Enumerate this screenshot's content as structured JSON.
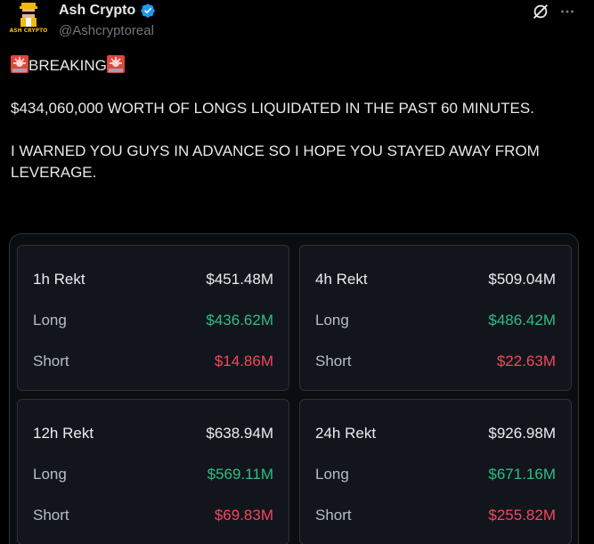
{
  "author": {
    "name": "Ash Crypto",
    "handle": "@Ashcryptoreal",
    "avatar_text": "ASH CRYPTO",
    "verified_icon": "verified-badge-icon"
  },
  "header_icons": [
    "grok-icon",
    "more-icon"
  ],
  "tweet": {
    "headline": "BREAKING",
    "paragraph_1": "$434,060,000 WORTH OF LONGS LIQUIDATED IN THE PAST 60 MINUTES.",
    "paragraph_2": "I WARNED YOU GUYS IN ADVANCE SO I HOPE YOU STAYED AWAY FROM LEVERAGE."
  },
  "colors": {
    "background": "#000000",
    "long": "#2ebd85",
    "short": "#f6465d",
    "verified": "#1d9bf0"
  },
  "rekt_cards": [
    {
      "title": "1h Rekt",
      "total": "$451.48M",
      "long_label": "Long",
      "long": "$436.62M",
      "short_label": "Short",
      "short": "$14.86M"
    },
    {
      "title": "4h Rekt",
      "total": "$509.04M",
      "long_label": "Long",
      "long": "$486.42M",
      "short_label": "Short",
      "short": "$22.63M"
    },
    {
      "title": "12h Rekt",
      "total": "$638.94M",
      "long_label": "Long",
      "long": "$569.11M",
      "short_label": "Short",
      "short": "$69.83M"
    },
    {
      "title": "24h Rekt",
      "total": "$926.98M",
      "long_label": "Long",
      "long": "$671.16M",
      "short_label": "Short",
      "short": "$255.82M"
    }
  ]
}
